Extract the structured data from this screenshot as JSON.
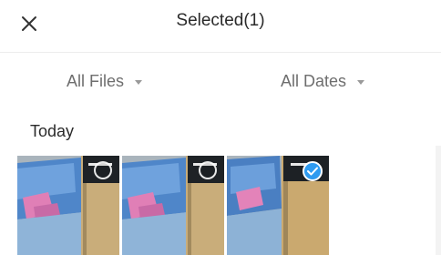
{
  "header": {
    "title": "Selected(1)",
    "close_icon": "close-icon"
  },
  "filters": {
    "files_label": "All Files",
    "dates_label": "All Dates"
  },
  "section": {
    "label": "Today"
  },
  "thumbnails": [
    {
      "selected": false,
      "icon": "selection-circle-icon"
    },
    {
      "selected": false,
      "icon": "selection-circle-icon"
    },
    {
      "selected": true,
      "icon": "checkmark-icon"
    }
  ],
  "colors": {
    "accent": "#2f9bf0",
    "title_text": "#2a2a2a",
    "filter_text": "#6e6e6e"
  }
}
